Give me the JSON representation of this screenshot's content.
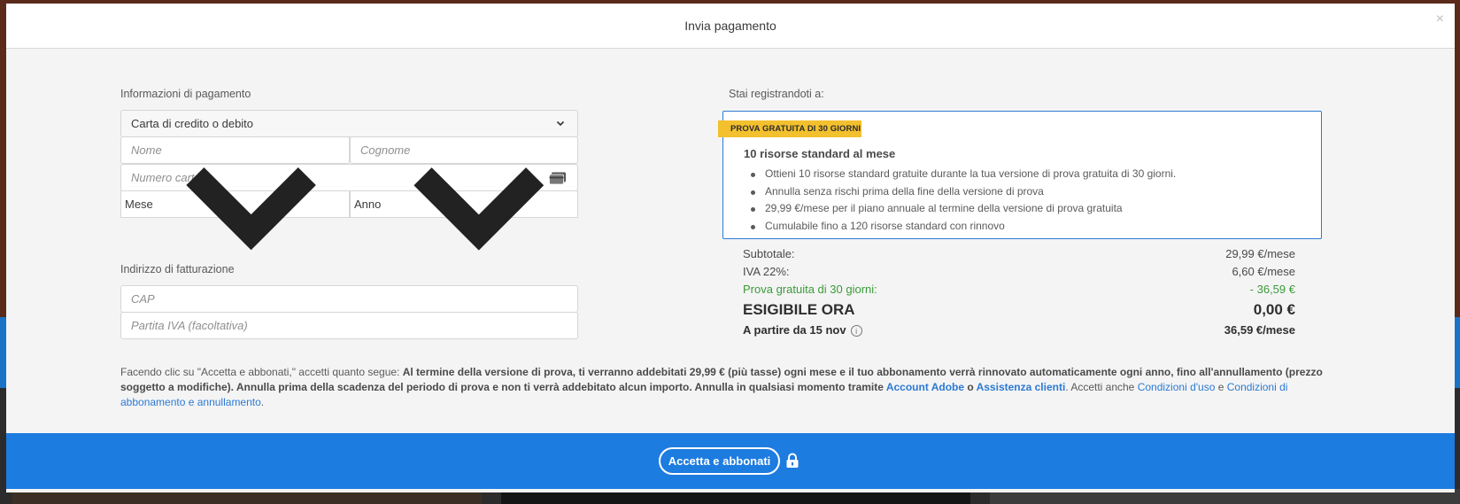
{
  "modal": {
    "title": "Invia pagamento",
    "close_label": "×"
  },
  "payment": {
    "section_label": "Informazioni di pagamento",
    "method_selected": "Carta di credito o debito",
    "first_name_placeholder": "Nome",
    "last_name_placeholder": "Cognome",
    "card_number_placeholder": "Numero carta",
    "month_selected": "Mese",
    "year_selected": "Anno"
  },
  "billing": {
    "section_label": "Indirizzo di fatturazione",
    "zip_placeholder": "CAP",
    "vat_placeholder": "Partita IVA (facoltativa)"
  },
  "plan": {
    "section_label": "Stai registrandoti a:",
    "badge": "PROVA GRATUITA DI 30 GIORNI",
    "title": "10 risorse standard al mese",
    "features": [
      "Ottieni 10 risorse standard gratuite durante la tua versione di prova gratuita di 30 giorni.",
      "Annulla senza rischi prima della fine della versione di prova",
      "29,99 €/mese per il piano annuale al termine della versione di prova gratuita",
      "Cumulabile fino a 120 risorse standard con rinnovo"
    ]
  },
  "totals": {
    "subtotal_label": "Subtotale:",
    "subtotal_value": "29,99 €/mese",
    "vat_label": "IVA 22%:",
    "vat_value": "6,60 €/mese",
    "trial_label": "Prova gratuita di 30 giorni:",
    "trial_value": "- 36,59 €",
    "due_label": "ESIGIBILE ORA",
    "due_value": "0,00 €",
    "from_label": "A partire da 15 nov",
    "from_value": "36,59 €/mese"
  },
  "legal": {
    "intro": "Facendo clic su \"Accetta e abbonati,\" accetti quanto segue: ",
    "bold_text": "Al termine della versione di prova, ti verranno addebitati 29,99 € (più tasse) ogni mese e il tuo abbonamento verrà rinnovato automaticamente ogni anno, fino all'annullamento (prezzo soggetto a modifiche). Annulla prima della scadenza del periodo di prova e non ti verrà addebitato alcun importo. Annulla in qualsiasi momento tramite ",
    "link_account": "Account Adobe",
    "or": " o ",
    "link_support": "Assistenza clienti",
    "accept_also": ". Accetti anche ",
    "link_terms": "Condizioni d'uso",
    "and": " e ",
    "link_subscription": "Condizioni di abbonamento e annullamento",
    "end": "."
  },
  "footer": {
    "submit_label": "Accetta e abbonati"
  },
  "colors": {
    "accent_blue": "#1d7ce0",
    "link_blue": "#2c7ad5",
    "badge_yellow": "#f3c02e",
    "trial_green": "#3a9a3a"
  }
}
